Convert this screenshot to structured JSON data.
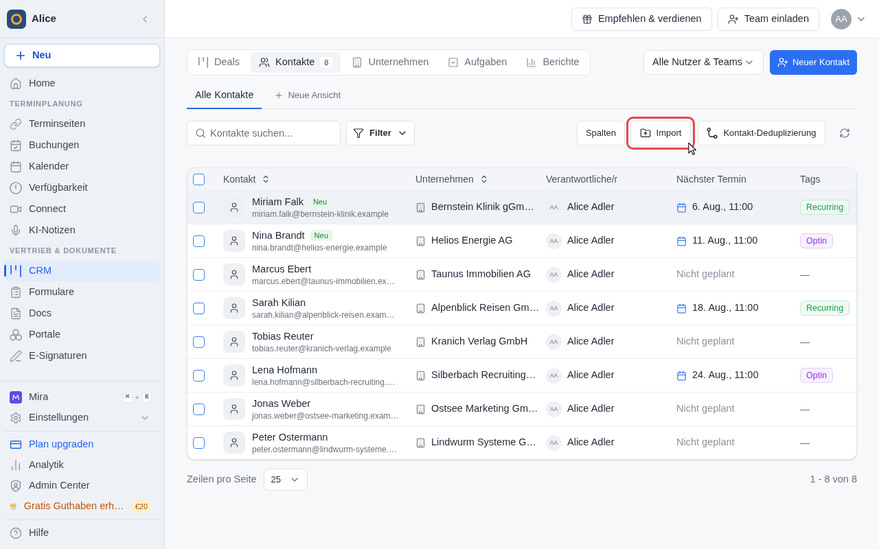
{
  "sidebar": {
    "workspace": "Alice",
    "new_button": "Neu",
    "nav": [
      {
        "kind": "item",
        "label": "Home",
        "selected": false
      },
      {
        "kind": "section",
        "label": "TERMINPLANUNG"
      },
      {
        "kind": "item",
        "label": "Terminseiten",
        "selected": false
      },
      {
        "kind": "item",
        "label": "Buchungen",
        "selected": false
      },
      {
        "kind": "item",
        "label": "Kalender",
        "selected": false
      },
      {
        "kind": "item",
        "label": "Verfügbarkeit",
        "selected": false
      },
      {
        "kind": "item",
        "label": "Connect",
        "selected": false
      },
      {
        "kind": "item",
        "label": "KI-Notizen",
        "selected": false
      },
      {
        "kind": "section",
        "label": "VERTRIEB & DOKUMENTE"
      },
      {
        "kind": "item",
        "label": "CRM",
        "selected": true
      },
      {
        "kind": "item",
        "label": "Formulare",
        "selected": false
      },
      {
        "kind": "item",
        "label": "Docs",
        "selected": false
      },
      {
        "kind": "item",
        "label": "Portale",
        "selected": false
      },
      {
        "kind": "item",
        "label": "E-Signaturen",
        "selected": false
      }
    ],
    "bottom_groups": [
      [
        {
          "kind": "assistant",
          "label": "Mira",
          "keys": [
            "⌘",
            "K"
          ],
          "joiner": "+"
        },
        {
          "kind": "menu",
          "label": "Einstellungen",
          "expanded": false
        }
      ],
      [
        {
          "kind": "upgrade",
          "label": "Plan upgraden"
        },
        {
          "kind": "link",
          "label": "Analytik"
        },
        {
          "kind": "link",
          "label": "Admin Center"
        },
        {
          "kind": "promo",
          "label": "Gratis Guthaben erh…",
          "badge": "€20"
        }
      ],
      [
        {
          "kind": "link",
          "label": "Hilfe"
        }
      ]
    ]
  },
  "header": {
    "buttons": [
      "Empfehlen & verdienen",
      "Team einladen"
    ],
    "avatar": "AA"
  },
  "tabs": [
    {
      "label": "Deals",
      "selected": false
    },
    {
      "label": "Kontakte",
      "count": "8",
      "selected": true
    },
    {
      "label": "Unternehmen",
      "selected": false
    },
    {
      "label": "Aufgaben",
      "selected": false
    },
    {
      "label": "Berichte",
      "selected": false
    }
  ],
  "owner_filter": {
    "value": "Alle Nutzer & Teams"
  },
  "primary_button": "Neuer Kontakt",
  "views": [
    {
      "label": "Alle Kontakte",
      "selected": true
    }
  ],
  "add_view": "Neue Ansicht",
  "toolbar": {
    "search": {
      "placeholder": "Kontakte suchen..."
    },
    "filter": "Filter",
    "actions": [
      {
        "label": "Spalten",
        "highlighted": false
      },
      {
        "label": "Import",
        "highlighted": true
      },
      {
        "label": "Kontakt-Deduplizierung",
        "highlighted": false
      }
    ]
  },
  "table": {
    "all_checked": false,
    "columns": [
      {
        "label": "Kontakt",
        "sortable": true
      },
      {
        "label": "Unternehmen",
        "sortable": true
      },
      {
        "label": "Verantwortliche/r",
        "sortable": false
      },
      {
        "label": "Nächster Termin",
        "sortable": false
      },
      {
        "label": "Tags",
        "sortable": false
      }
    ],
    "rows": [
      {
        "checked": false,
        "hovered": true,
        "name": "Miriam Falk",
        "badge": "Neu",
        "email": "miriam.falk@bernstein-klinik.example",
        "company": "Bernstein Klinik gGm…",
        "owner_initials": "AA",
        "owner": "Alice Adler",
        "next": {
          "kind": "date",
          "text": "6. Aug., 11:00"
        },
        "tag": {
          "kind": "badge",
          "label": "Recurring",
          "color": "#16a34a"
        }
      },
      {
        "checked": false,
        "hovered": false,
        "name": "Nina Brandt",
        "badge": "Neu",
        "email": "nina.brandt@helios-energie.example",
        "company": "Helios Energie AG",
        "owner_initials": "AA",
        "owner": "Alice Adler",
        "next": {
          "kind": "date",
          "text": "11. Aug., 11:00"
        },
        "tag": {
          "kind": "badge",
          "label": "Optin",
          "color": "#9333ea"
        }
      },
      {
        "checked": false,
        "hovered": false,
        "name": "Marcus Ebert",
        "email": "marcus.ebert@taunus-immobilien.ex…",
        "company": "Taunus Immobilien AG",
        "owner_initials": "AA",
        "owner": "Alice Adler",
        "next": {
          "kind": "unscheduled",
          "text": "Nicht geplant"
        },
        "tag": {
          "kind": "empty",
          "label": "—"
        }
      },
      {
        "checked": false,
        "hovered": false,
        "name": "Sarah Kilian",
        "email": "sarah.kilian@alpenblick-reisen.exam…",
        "company": "Alpenblick Reisen Gm…",
        "owner_initials": "AA",
        "owner": "Alice Adler",
        "next": {
          "kind": "date",
          "text": "18. Aug., 11:00"
        },
        "tag": {
          "kind": "badge",
          "label": "Recurring",
          "color": "#16a34a"
        }
      },
      {
        "checked": false,
        "hovered": false,
        "name": "Tobias Reuter",
        "email": "tobias.reuter@kranich-verlag.example",
        "company": "Kranich Verlag GmbH",
        "owner_initials": "AA",
        "owner": "Alice Adler",
        "next": {
          "kind": "unscheduled",
          "text": "Nicht geplant"
        },
        "tag": {
          "kind": "empty",
          "label": "—"
        }
      },
      {
        "checked": false,
        "hovered": false,
        "name": "Lena Hofmann",
        "email": "lena.hofmann@silberbach-recruiting.…",
        "company": "Silberbach Recruiting…",
        "owner_initials": "AA",
        "owner": "Alice Adler",
        "next": {
          "kind": "date",
          "text": "24. Aug., 11:00"
        },
        "tag": {
          "kind": "badge",
          "label": "Optin",
          "color": "#9333ea"
        }
      },
      {
        "checked": false,
        "hovered": false,
        "name": "Jonas Weber",
        "email": "jonas.weber@ostsee-marketing.exam…",
        "company": "Ostsee Marketing Gm…",
        "owner_initials": "AA",
        "owner": "Alice Adler",
        "next": {
          "kind": "unscheduled",
          "text": "Nicht geplant"
        },
        "tag": {
          "kind": "empty",
          "label": "—"
        }
      },
      {
        "checked": false,
        "hovered": false,
        "name": "Peter Ostermann",
        "email": "peter.ostermann@lindwurm-systeme.…",
        "company": "Lindwurm Systeme G…",
        "owner_initials": "AA",
        "owner": "Alice Adler",
        "next": {
          "kind": "unscheduled",
          "text": "Nicht geplant"
        },
        "tag": {
          "kind": "empty",
          "label": "—"
        }
      }
    ]
  },
  "pagination": {
    "label": "Zeilen pro Seite",
    "page_size": "25",
    "range": "1 - 8 von 8"
  }
}
